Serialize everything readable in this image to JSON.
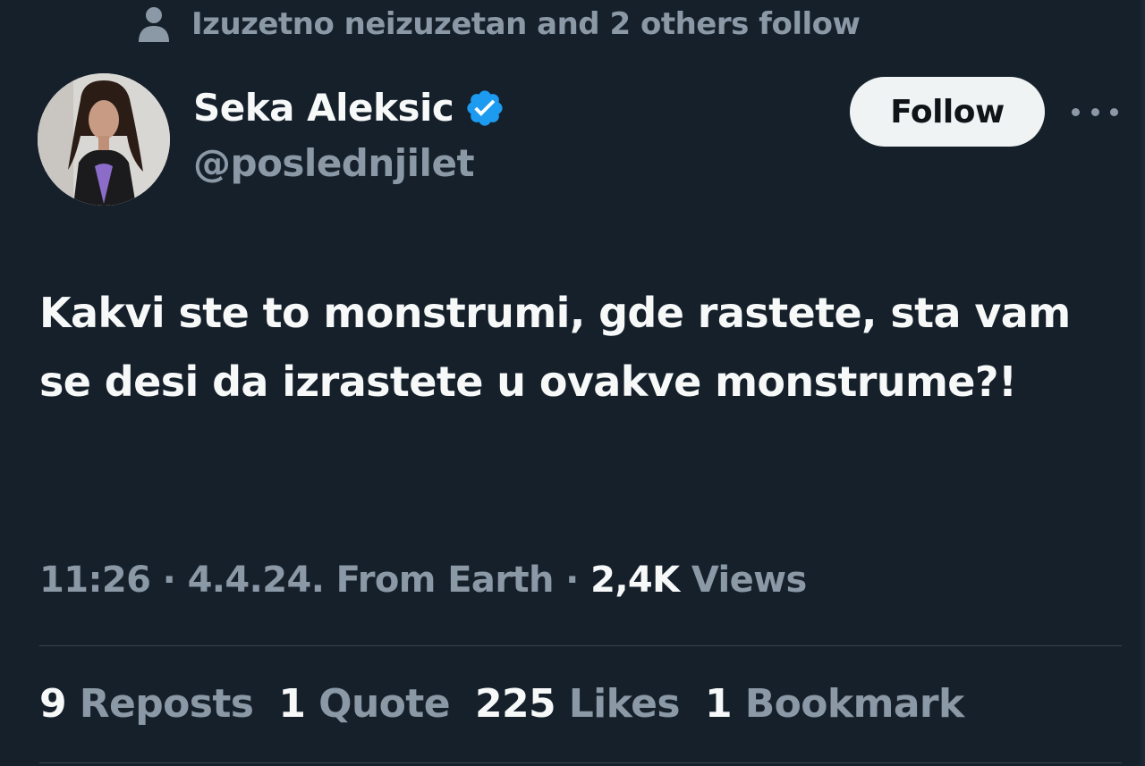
{
  "social_context": {
    "icon": "person-icon",
    "text": "Izuzetno neizuzetan and 2 others follow"
  },
  "author": {
    "display_name": "Seka Aleksic",
    "handle": "@poslednjilet",
    "verified_icon": "verified-badge-icon",
    "verified_color": "#1d9bf0"
  },
  "follow_button": {
    "label": "Follow"
  },
  "more_icon": "more-horizontal-icon",
  "tweet": {
    "text": "Kakvi ste to monstrumi, gde rastete, sta vam se desi da izrastete u ovakve monstrume?!"
  },
  "meta": {
    "time": "11:26",
    "sep1": " · ",
    "date": "4.4.24.",
    "source": " From Earth",
    "sep2": " · ",
    "views_count": "2,4K",
    "views_label": " Views"
  },
  "stats": [
    {
      "count": "9",
      "label": "Reposts"
    },
    {
      "count": "1",
      "label": "Quote"
    },
    {
      "count": "225",
      "label": "Likes"
    },
    {
      "count": "1",
      "label": "Bookmark"
    }
  ],
  "colors": {
    "background": "#15202b",
    "primary_text": "#f7f9f9",
    "secondary_text": "#8b98a5",
    "divider": "#38444d",
    "follow_bg": "#eff3f4"
  }
}
